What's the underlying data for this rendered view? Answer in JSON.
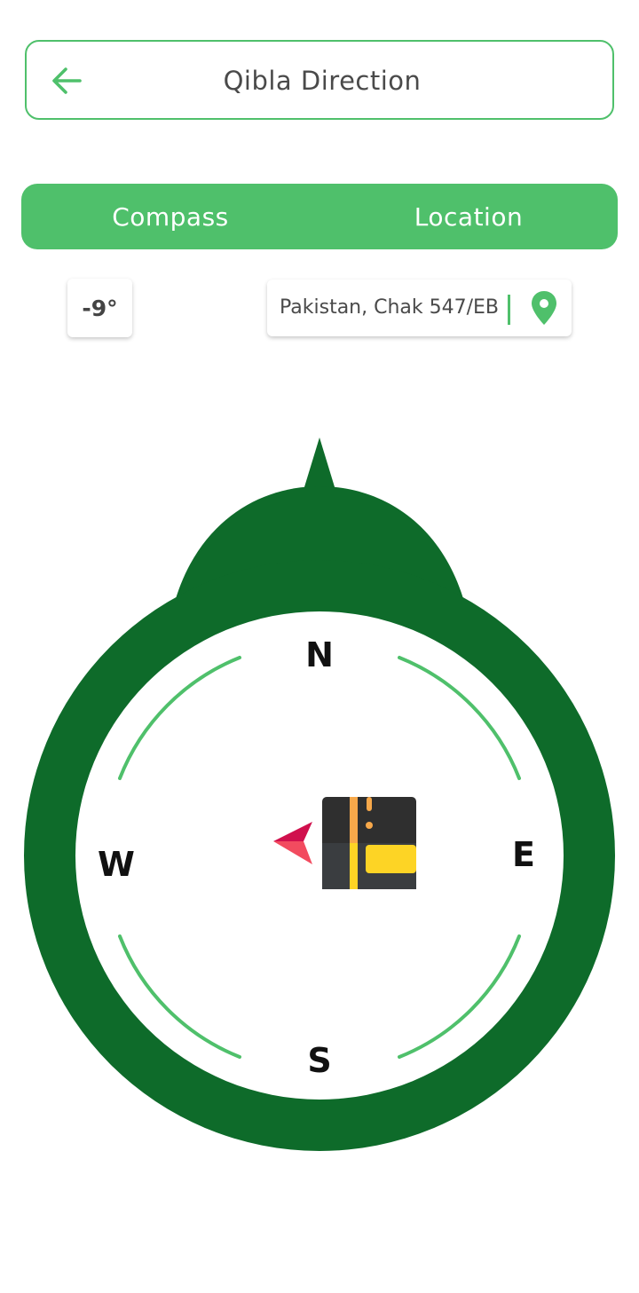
{
  "header": {
    "title": "Qibla Direction",
    "back_icon": "arrow-left-icon"
  },
  "tabs": [
    {
      "label": "Compass"
    },
    {
      "label": "Location"
    }
  ],
  "heading": {
    "degrees": "-9°"
  },
  "location": {
    "text": "Pakistan, Chak 547/EB",
    "icon": "map-pin-icon"
  },
  "compass": {
    "north": "N",
    "east": "E",
    "south": "S",
    "west": "W",
    "needle_icon": "qibla-needle-icon",
    "kaaba_icon": "kaaba-icon"
  },
  "colors": {
    "accent": "#4fc06b",
    "compass_ring": "#0e6b2a",
    "needle_red": "#e8334f",
    "kaaba_black": "#2f2f2f",
    "kaaba_gold": "#fdd425"
  }
}
